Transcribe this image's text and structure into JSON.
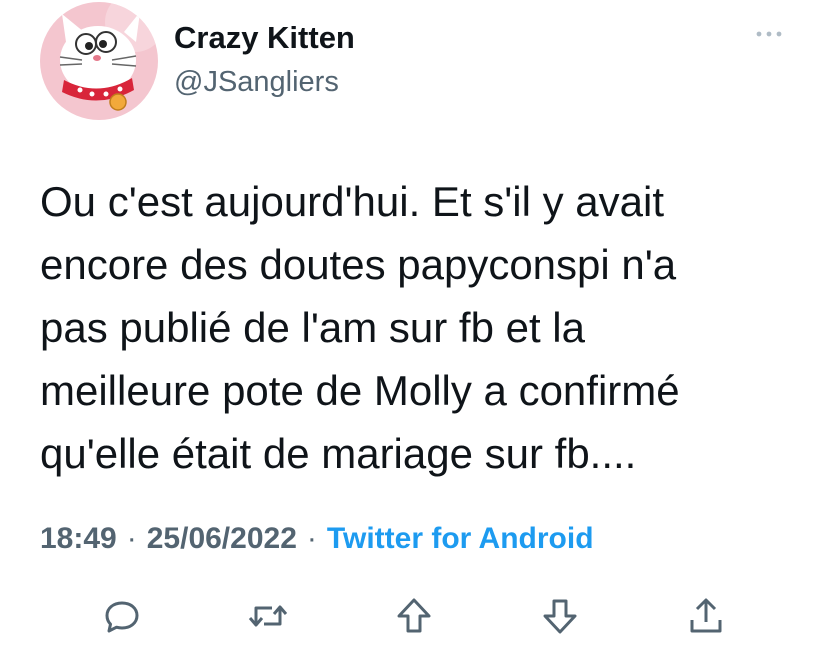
{
  "author": {
    "display_name": "Crazy Kitten",
    "handle": "@JSangliers"
  },
  "tweet": {
    "lines": [
      "Ou c'est aujourd'hui. Et s'il y avait",
      "encore des doutes papyconspi n'a",
      "pas publié de l'am sur fb et la",
      "meilleure pote de Molly a confirmé",
      "qu'elle était de mariage sur fb...."
    ]
  },
  "meta": {
    "time": "18:49",
    "separator": "·",
    "date": "25/06/2022",
    "source": "Twitter for Android"
  },
  "actions": {
    "icons": [
      "reply-icon",
      "retweet-icon",
      "upvote-icon",
      "downvote-icon",
      "share-icon"
    ]
  },
  "colors": {
    "text": "#0f1419",
    "muted": "#536471",
    "accent": "#1d9bf0",
    "icon": "#536471"
  }
}
